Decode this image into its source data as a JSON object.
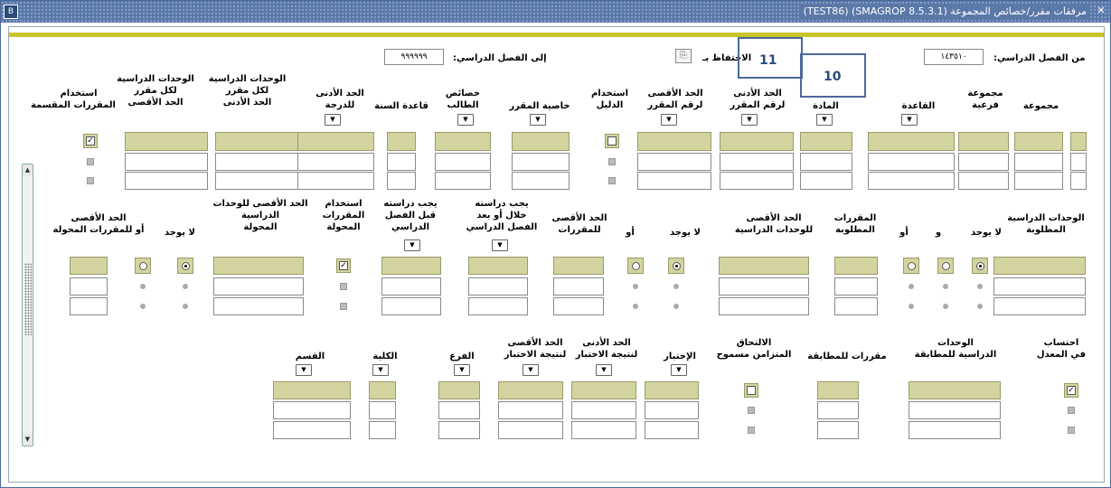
{
  "window": {
    "title": "مرفقات مقرر/خصائص المجموعة  (SMAGROP  8.5.3.1)  (TEST86)",
    "close_glyph": "✕",
    "app_icon": "B"
  },
  "key_block": {
    "from_term_label": "من الفصل الدراسي:",
    "from_term_value": "١٤٣٥١٠",
    "to_term_label": "إلى الفصل الدراسي:",
    "to_term_value": "٩٩٩٩٩٩",
    "keep_label": "الاحتفاظ بـ"
  },
  "callouts": {
    "a": "11",
    "b": "10"
  },
  "section1": {
    "labels": {
      "group": "مجموعة",
      "subgroup": "مجموعة\nفرعية",
      "rule": "القاعدة",
      "subject": "المادة",
      "min_course_no": "الحد الأدنى\nلرقم المقرر",
      "max_course_no": "الحد الأقصى\nلرقم المقرر",
      "use_catalog": "استخدام\nالدليل",
      "course_attr": "خاصية المقرر",
      "student_attr": "خصائص\nالطالب",
      "year_rule": "قاعدة السنة",
      "min_grade": "الحد الأدنى\nللدرجة",
      "min_units_per_course": "الوحدات الدراسية\nلكل مقرر\nالحد الأدنى",
      "max_units_per_course": "الوحدات الدراسية\nلكل مقرر\nالحد الأقصى",
      "use_split": "استخدام\nالمقررات المقسمة"
    }
  },
  "section2": {
    "labels": {
      "req_units": "الوحدات الدراسية\nالمطلوبة",
      "not_exist": "لا يوجد",
      "and": "و",
      "or": "أو",
      "req_courses": "المقررات\nالمطلوبة",
      "max_units": "الحد الأقصى\nللوحدات الدراسية",
      "not_exist2": "لا يوجد",
      "or2": "أو",
      "max_courses": "الحد الأقصى\nللمقررات",
      "must_take_within": "يجب دراسته\nخلال أو بعد\nالفصل الدراسي",
      "must_take_before": "يجب دراسته\nقبل الفصل\nالدراسي",
      "use_transfer": "استخدام\nالمقررات\nالمحولة",
      "max_transfer_units": "الحد الأقصى للوحدات\nالدراسية\nالمحولة",
      "not_exist3": "لا يوجد",
      "max_transfer_courses": "الحد الأقصى\nأو للمقررات المحولة"
    }
  },
  "section3": {
    "labels": {
      "gpa_calc": "احتساب\nفي المعدل",
      "match_units": "الوحدات\nالدراسية للمطابقة",
      "match_courses": "مقررات للمطابقة",
      "concurrent": "الالتحاق\nالمتزامن مسموح",
      "test": "الإختبار",
      "test_min": "الحد الأدنى\nلنتيجة الاختبار",
      "test_max": "الحد الأقصى\nلنتيجة الاختبار",
      "branch": "الفرع",
      "college": "الكلية",
      "dept": "القسم"
    }
  },
  "glyphs": {
    "dropdown": "▼",
    "check": "✓",
    "scroll_up": "▲",
    "scroll_down": "▼",
    "keep_icon": "⎘"
  }
}
